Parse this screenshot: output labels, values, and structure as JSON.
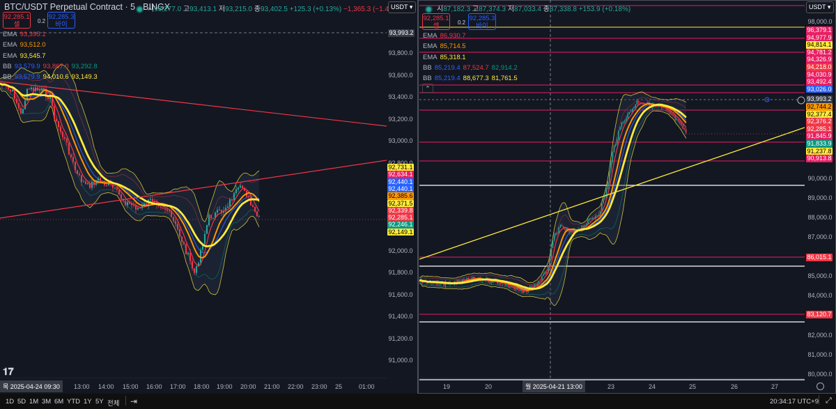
{
  "colors": {
    "background": "#131722",
    "up": "#26a69a",
    "down": "#f23645",
    "ema_fast": "#f23645",
    "ema_mid": "#ff9800",
    "ema_slow": "#ffeb3b",
    "bb_basis": "#2962ff",
    "trendline_pink": "#f23645",
    "trendline_yellow": "#ffeb3b"
  },
  "left": {
    "title": "BTC/USDT Perpetual Contract · 5 · BINGX",
    "ohlc": {
      "o_label": "시",
      "o": "93,277.0",
      "h_label": "고",
      "h": "93,413.1",
      "l_label": "저",
      "l": "93,215.0",
      "c_label": "종",
      "c": "93,402.5",
      "chg": "+125.3 (+0.13%)",
      "chg2": "−1,365.3 (−1.46%)"
    },
    "sell": {
      "price": "92,285.1",
      "label": "셀"
    },
    "spread": "0.2",
    "buy": {
      "price": "92,285.3",
      "label": "바이"
    },
    "legends": [
      {
        "name": "EMA",
        "v": [
          "93,395.1"
        ]
      },
      {
        "name": "EMA",
        "v": [
          "93,512.0"
        ]
      },
      {
        "name": "EMA",
        "v": [
          "93,545.7"
        ]
      },
      {
        "name": "BB",
        "v": [
          "93,579.9",
          "93,867.0",
          "93,292.8"
        ]
      },
      {
        "name": "BB",
        "v": [
          "93,579.9",
          "94,010.6",
          "93,149.3"
        ]
      }
    ],
    "currency": "USDT",
    "axis_labels": [
      "93,800.0",
      "93,600.0",
      "93,400.0",
      "93,200.0",
      "93,000.0",
      "92,800.0",
      "92,000.0",
      "91,800.0",
      "91,600.0",
      "91,400.0",
      "91,200.0",
      "91,000.0"
    ],
    "crosshair_price": "93,993.2",
    "tags": [
      {
        "v": "92,731.1",
        "c": "#ffeb3b"
      },
      {
        "v": "92,634.1",
        "c": "#e91e63"
      },
      {
        "v": "92,440.1",
        "c": "#2962ff"
      },
      {
        "v": "92,440.1",
        "c": "#2962ff"
      },
      {
        "v": "92,385.6",
        "c": "#ff9800"
      },
      {
        "v": "92,371.5",
        "c": "#ffeb3b"
      },
      {
        "v": "92,339.8",
        "c": "#f23645"
      },
      {
        "v": "92,285.1",
        "c": "#f23645"
      },
      {
        "v": "92,246.1",
        "c": "#089981"
      },
      {
        "v": "92,149.1",
        "c": "#ffeb3b"
      }
    ],
    "crosshair_time": "목 2025-04-24   09:30",
    "time_labels": [
      "13:00",
      "14:00",
      "15:00",
      "16:00",
      "17:00",
      "18:00",
      "19:00",
      "20:00",
      "21:00",
      "22:00",
      "23:00",
      "25",
      "01:00"
    ]
  },
  "right": {
    "ohlc": {
      "o_label": "시",
      "o": "87,182.3",
      "h_label": "고",
      "h": "87,374.3",
      "l_label": "저",
      "l": "87,033.4",
      "c_label": "종",
      "c": "87,338.8",
      "chg": "+153.9 (+0.18%)"
    },
    "sell": {
      "price": "92,285.1",
      "label": "셀"
    },
    "spread": "0.2",
    "buy": {
      "price": "92,285.3",
      "label": "바이"
    },
    "legends": [
      {
        "name": "EMA",
        "v": [
          "86,930.7"
        ]
      },
      {
        "name": "EMA",
        "v": [
          "85,714.5"
        ]
      },
      {
        "name": "EMA",
        "v": [
          "85,318.1"
        ]
      },
      {
        "name": "BB",
        "v": [
          "85,219.4",
          "87,524.7",
          "82,914.2"
        ]
      },
      {
        "name": "BB",
        "v": [
          "85,219.4",
          "88,677.3",
          "81,761.5"
        ]
      }
    ],
    "currency": "USDT",
    "axis_labels": [
      "98,000.0",
      "90,000.0",
      "89,000.0",
      "88,000.0",
      "87,000.0",
      "85,000.0",
      "84,000.0",
      "82,000.0",
      "81,000.0",
      "80,000.0"
    ],
    "tags": [
      {
        "v": "96,379.1",
        "c": "#e91e63"
      },
      {
        "v": "94,977.9",
        "c": "#e91e63"
      },
      {
        "v": "94,814.1",
        "c": "#ffeb3b"
      },
      {
        "v": "94,781.2",
        "c": "#e91e63"
      },
      {
        "v": "94,326.9",
        "c": "#e91e63"
      },
      {
        "v": "94,218.0",
        "c": "#f23645"
      },
      {
        "v": "94,030.9",
        "c": "#e91e63"
      },
      {
        "v": "93,492.4",
        "c": "#e91e63"
      },
      {
        "v": "93,026.0",
        "c": "#2962ff"
      },
      {
        "v": "93,993.2",
        "c": "#363a45"
      },
      {
        "v": "92,744.2",
        "c": "#ff9800"
      },
      {
        "v": "92,377.4",
        "c": "#ffeb3b"
      },
      {
        "v": "92,376.2",
        "c": "#f23645"
      },
      {
        "v": "92,285.1",
        "c": "#f23645"
      },
      {
        "v": "91,845.9",
        "c": "#e91e63"
      },
      {
        "v": "91,833.9",
        "c": "#089981"
      },
      {
        "v": "91,237.8",
        "c": "#ffeb3b"
      },
      {
        "v": "90,913.8",
        "c": "#e91e63"
      }
    ],
    "level_tags": [
      {
        "v": "86,015.1",
        "c": "#f23645"
      },
      {
        "v": "83,120.7",
        "c": "#f23645"
      }
    ],
    "crosshair_time": "월 2025-04-21   13:00",
    "time_labels": [
      "19",
      "20",
      "23",
      "24",
      "25",
      "26",
      "27"
    ]
  },
  "bottom": {
    "ranges": [
      "1D",
      "5D",
      "1M",
      "3M",
      "6M",
      "YTD",
      "1Y",
      "5Y",
      "전체"
    ],
    "clock": "20:34:17 UTC+9"
  },
  "icons": {
    "logo": "tradingview-logo",
    "date_range": "calendar-goto-icon",
    "settings": "gear-icon",
    "fullscreen": "fullscreen-icon",
    "add": "plus-circle-icon",
    "collapse": "chevron-up-icon"
  }
}
